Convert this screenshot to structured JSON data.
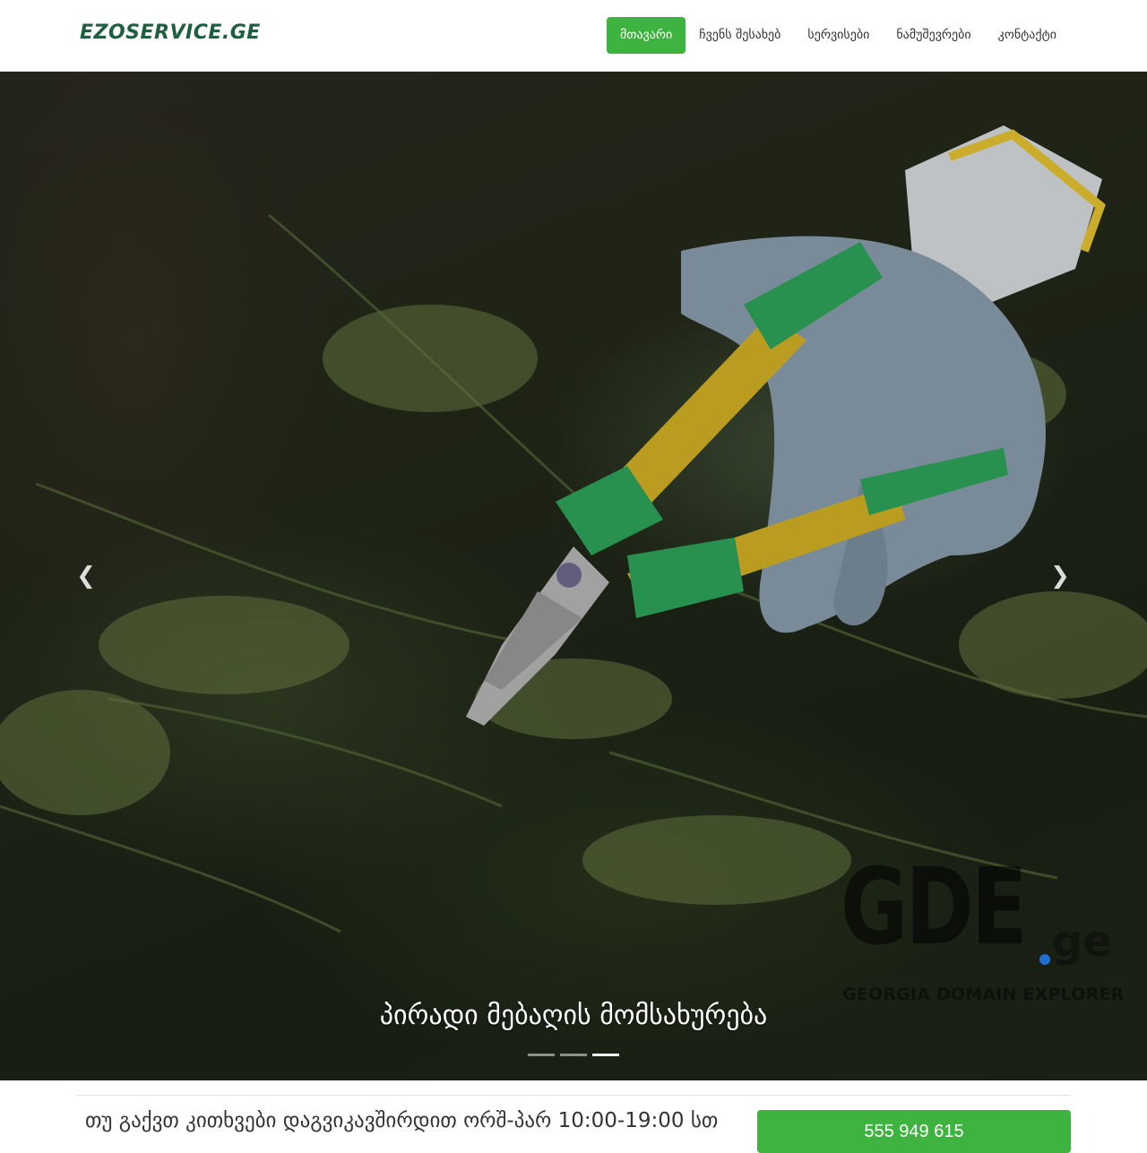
{
  "header": {
    "brand": "EZOSERVICE.GE",
    "nav": [
      {
        "label": "მთავარი",
        "active": true
      },
      {
        "label": "ჩვენს შესახებ",
        "active": false
      },
      {
        "label": "სერვისები",
        "active": false
      },
      {
        "label": "ნამუშევრები",
        "active": false
      },
      {
        "label": "კონტაქტი",
        "active": false
      }
    ]
  },
  "hero": {
    "caption": "პირადი მებაღის მომსახურება",
    "slide_count": 3,
    "active_slide": 3,
    "prev_icon": "chevron-left-icon",
    "next_icon": "chevron-right-icon"
  },
  "watermark": {
    "main": "GDE",
    "ext": "ge",
    "subtitle": "GEORGIA DOMAIN EXPLORER"
  },
  "contact": {
    "text": "თუ გაქვთ კითხვები დაგვიკავშირდით ორშ-პარ 10:00-19:00 სთ",
    "phone": "555 949 615"
  },
  "colors": {
    "accent": "#3fb340",
    "brand": "#1d5f3f"
  }
}
